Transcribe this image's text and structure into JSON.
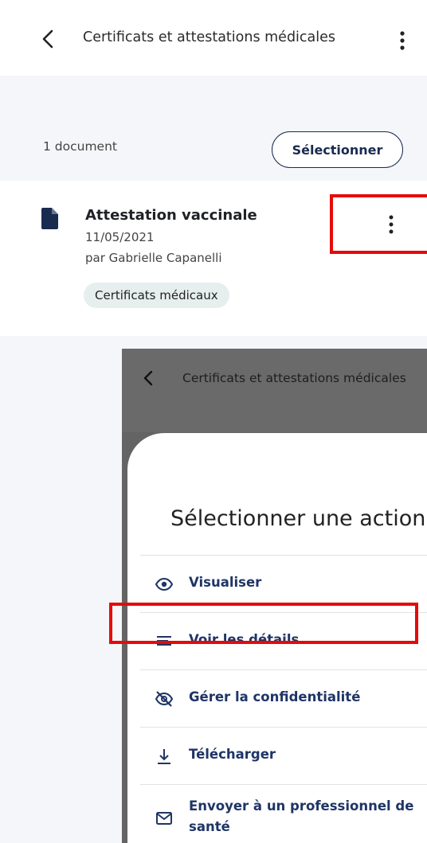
{
  "appbar": {
    "title": "Certificats et attestations médicales",
    "back_icon": "chevron-left-icon",
    "more_icon": "more-vertical-icon"
  },
  "toolbar": {
    "count": "1 document",
    "select_label": "Sélectionner"
  },
  "document": {
    "name": "Attestation vaccinale",
    "date": "11/05/2021",
    "author": "par Gabrielle Capanelli",
    "tag": "Certificats médicaux",
    "icon": "file-icon"
  },
  "embedded": {
    "title": "Certificats et attestations médicales",
    "sheet_title": "Sélectionner une action",
    "actions": [
      {
        "label": "Visualiser",
        "icon": "eye-icon"
      },
      {
        "label": "Voir les détails",
        "icon": "details-lines-icon"
      },
      {
        "label": "Gérer la confidentialité",
        "icon": "eye-off-icon"
      },
      {
        "label": "Télécharger",
        "icon": "download-icon"
      },
      {
        "label": "Envoyer à un professionnel de santé",
        "icon": "mail-icon"
      }
    ]
  },
  "colors": {
    "accent": "#1f3566",
    "highlight": "#e60a0a",
    "panel": "#f4f6fa",
    "overlay": "#646464"
  }
}
